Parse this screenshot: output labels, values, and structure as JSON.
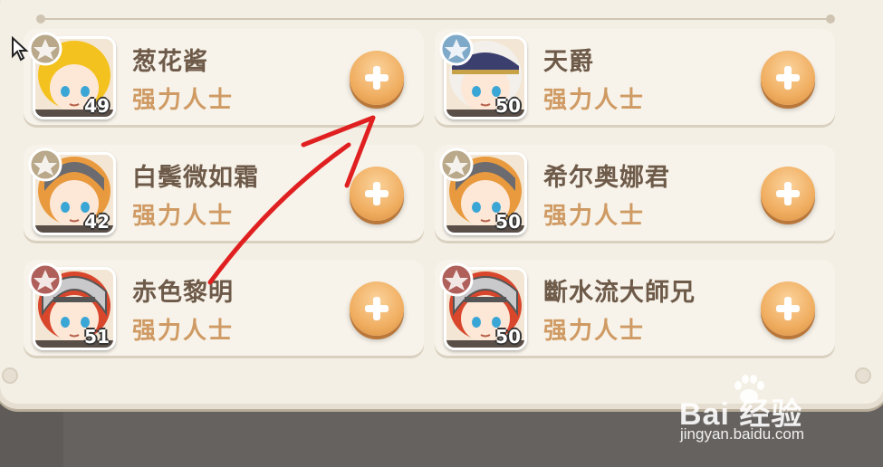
{
  "friends": [
    {
      "name": "葱花酱",
      "title": "强力人士",
      "level": "49",
      "hair": "#f4c21f",
      "badge": "#b9a889",
      "theme": "blonde",
      "add": "add-friend"
    },
    {
      "name": "天爵",
      "title": "强力人士",
      "level": "50",
      "hair": "#f3f0ec",
      "badge": "#7ea9c8",
      "theme": "captain",
      "add": "add-friend"
    },
    {
      "name": "白鬓微如霜",
      "title": "强力人士",
      "level": "42",
      "hair": "#e99a3e",
      "badge": "#b9a889",
      "theme": "knight",
      "add": "add-friend"
    },
    {
      "name": "希尔奥娜君",
      "title": "强力人士",
      "level": "50",
      "hair": "#e99a3e",
      "badge": "#b9a889",
      "theme": "knight",
      "add": "add-friend"
    },
    {
      "name": "赤色黎明",
      "title": "强力人士",
      "level": "51",
      "hair": "#d8462c",
      "badge": "#b0605a",
      "theme": "helmet",
      "add": "add-friend"
    },
    {
      "name": "斷水流大師兄",
      "title": "强力人士",
      "level": "50",
      "hair": "#d8462c",
      "badge": "#b0605a",
      "theme": "helmet",
      "add": "add-friend"
    }
  ],
  "watermark": {
    "logo": "Bai  经验",
    "url": "jingyan.baidu.com"
  },
  "colors": {
    "panel": "#f4efe4",
    "card": "#f7f3ea",
    "name_text": "#6e5a49",
    "title_text": "#cf9a63",
    "add_button": "#f0ae61",
    "annotation_arrow": "#e02020"
  }
}
